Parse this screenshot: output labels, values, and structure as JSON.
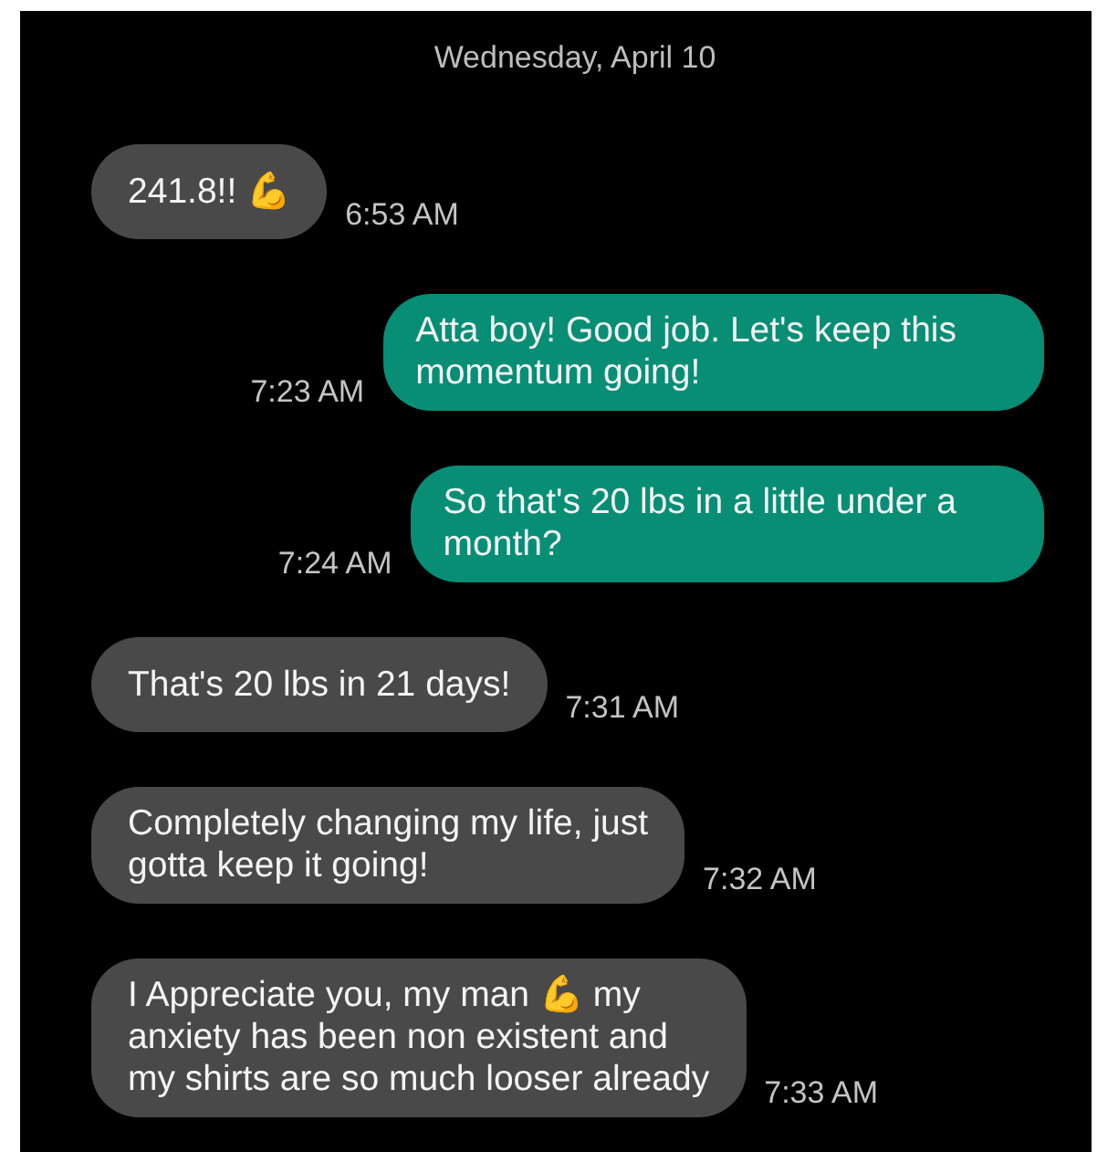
{
  "date_header": "Wednesday, April 10",
  "messages": [
    {
      "kind": "incoming",
      "text": "241.8!! 💪",
      "time": "6:53 AM"
    },
    {
      "kind": "outgoing",
      "text": "Atta boy! Good job. Let's keep this\nmomentum going!",
      "time": "7:23 AM"
    },
    {
      "kind": "outgoing",
      "text": "So that's 20 lbs in a little under a\nmonth?",
      "time": "7:24 AM"
    },
    {
      "kind": "incoming",
      "text": "That's 20 lbs in 21 days!",
      "time": "7:31 AM"
    },
    {
      "kind": "incoming",
      "text": "Completely changing my life, just\ngotta keep it going!",
      "time": "7:32 AM"
    },
    {
      "kind": "incoming",
      "text": "I Appreciate you, my man 💪 my\nanxiety has been non existent and\nmy shirts are so much looser already",
      "time": "7:33 AM"
    }
  ]
}
